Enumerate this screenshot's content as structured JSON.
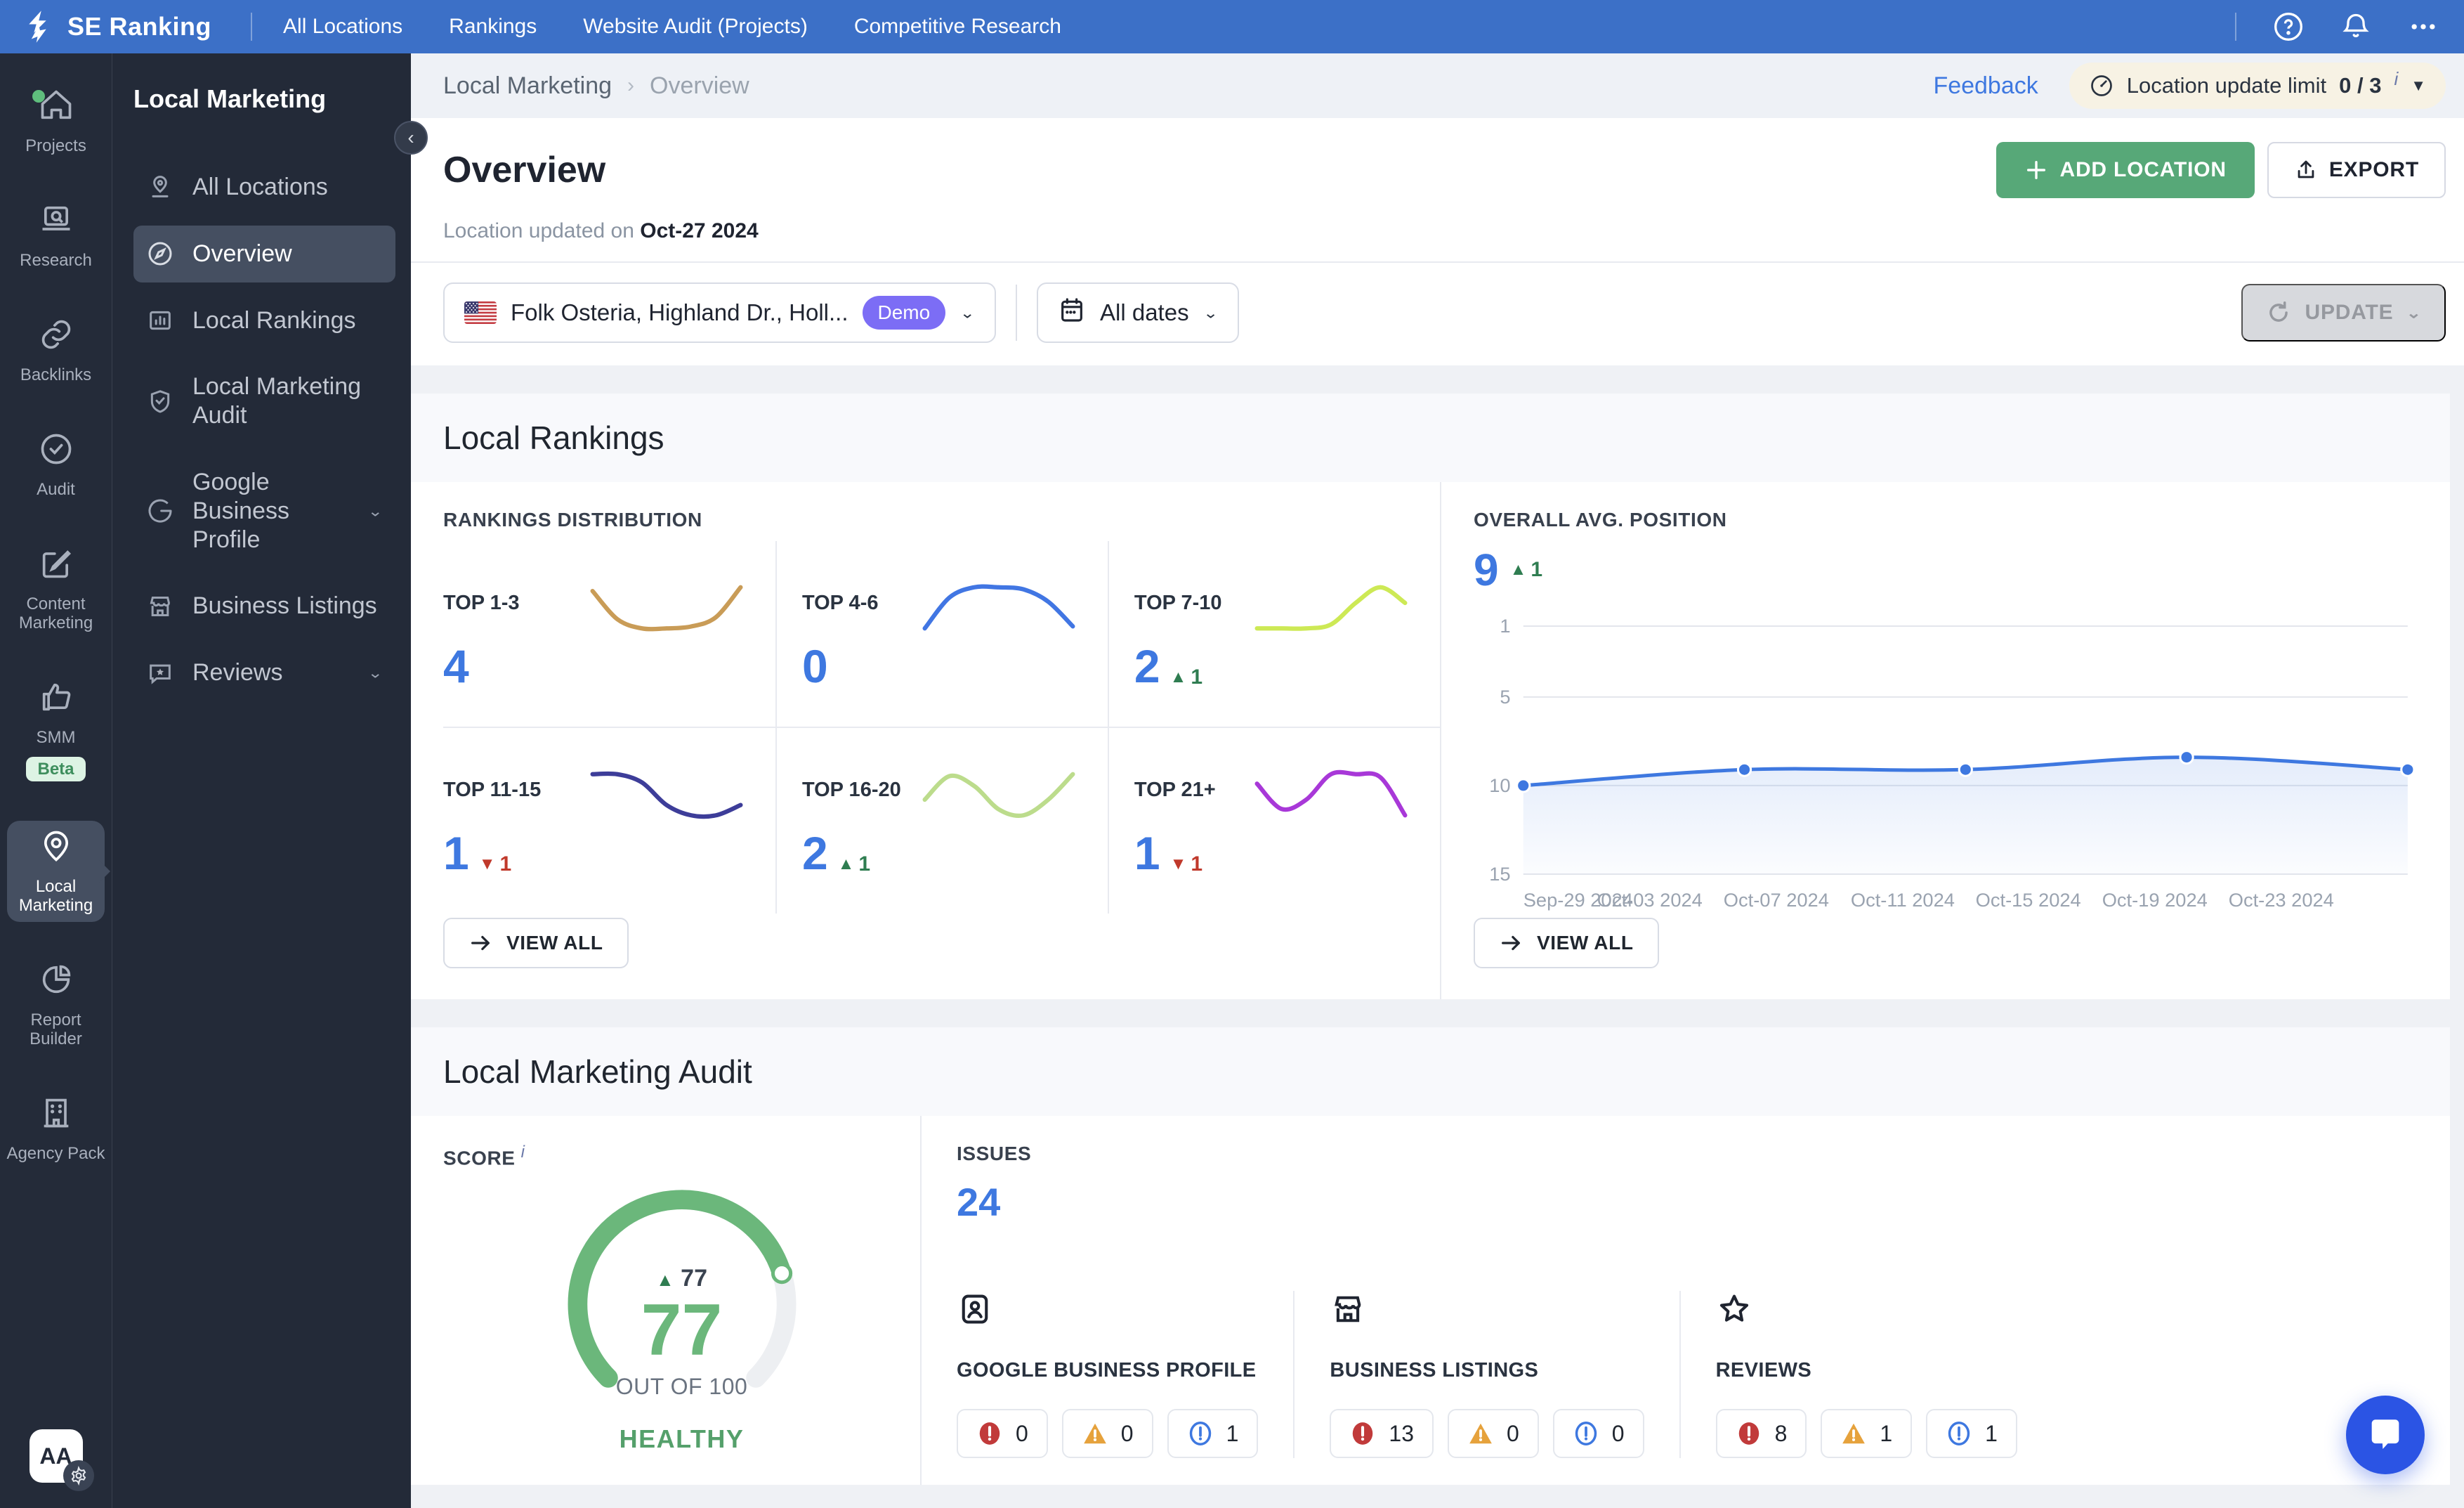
{
  "topnav": {
    "brand": "SE Ranking",
    "items": [
      "All Locations",
      "Rankings",
      "Website Audit (Projects)",
      "Competitive Research"
    ]
  },
  "rail": {
    "items": [
      {
        "label": "Projects",
        "icon": "home-icon"
      },
      {
        "label": "Research",
        "icon": "research-icon"
      },
      {
        "label": "Backlinks",
        "icon": "backlinks-icon"
      },
      {
        "label": "Audit",
        "icon": "audit-check-icon"
      },
      {
        "label": "Content Marketing",
        "icon": "content-marketing-icon"
      },
      {
        "label": "SMM",
        "icon": "thumbs-up-icon",
        "badge": "Beta"
      },
      {
        "label": "Local Marketing",
        "icon": "map-pin-icon"
      },
      {
        "label": "Report Builder",
        "icon": "pie-chart-icon"
      },
      {
        "label": "Agency Pack",
        "icon": "building-icon"
      }
    ],
    "avatar": "AA"
  },
  "sidebar": {
    "title": "Local Marketing",
    "items": [
      {
        "label": "All Locations",
        "icon": "location-pin-icon"
      },
      {
        "label": "Overview",
        "icon": "compass-icon"
      },
      {
        "label": "Local Rankings",
        "icon": "bar-chart-icon"
      },
      {
        "label": "Local Marketing Audit",
        "icon": "shield-check-icon"
      },
      {
        "label": "Google Business Profile",
        "icon": "google-icon"
      },
      {
        "label": "Business Listings",
        "icon": "storefront-icon"
      },
      {
        "label": "Reviews",
        "icon": "review-bubble-icon"
      }
    ]
  },
  "header": {
    "breadcrumb_root": "Local Marketing",
    "breadcrumb_current": "Overview",
    "feedback": "Feedback",
    "limit_label": "Location update limit",
    "limit_value": "0 / 3",
    "limit_info": "i",
    "title": "Overview",
    "updated_label": "Location updated on",
    "updated_date": "Oct-27 2024",
    "add_location": "ADD LOCATION",
    "export": "EXPORT"
  },
  "filters": {
    "location": "Folk Osteria, Highland Dr., Holl...",
    "location_badge": "Demo",
    "dates": "All dates",
    "update": "UPDATE"
  },
  "rankings": {
    "section_title": "Local Rankings",
    "distribution_title": "RANKINGS DISTRIBUTION",
    "view_all": "VIEW ALL",
    "cards": [
      {
        "label": "TOP 1-3",
        "value": "4",
        "delta": "",
        "dir": ""
      },
      {
        "label": "TOP 4-6",
        "value": "0",
        "delta": "",
        "dir": ""
      },
      {
        "label": "TOP 7-10",
        "value": "2",
        "delta": "1",
        "dir": "up"
      },
      {
        "label": "TOP 11-15",
        "value": "1",
        "delta": "1",
        "dir": "down"
      },
      {
        "label": "TOP 16-20",
        "value": "2",
        "delta": "1",
        "dir": "up"
      },
      {
        "label": "TOP 21+",
        "value": "1",
        "delta": "1",
        "dir": "down"
      }
    ],
    "avg_title": "OVERALL AVG. POSITION",
    "avg_value": "9",
    "avg_delta": "1",
    "avg_view_all": "VIEW ALL"
  },
  "audit": {
    "section_title": "Local Marketing Audit",
    "score_label": "SCORE",
    "score_info": "i",
    "score_delta": "77",
    "score_value": "77",
    "score_out_of": "OUT OF 100",
    "score_status": "HEALTHY",
    "issues_label": "ISSUES",
    "issues_value": "24",
    "categories": [
      {
        "label": "GOOGLE BUSINESS PROFILE",
        "icon": "profile-card-icon",
        "errors": "0",
        "warnings": "0",
        "notices": "1"
      },
      {
        "label": "BUSINESS LISTINGS",
        "icon": "storefront-icon",
        "errors": "13",
        "warnings": "0",
        "notices": "0"
      },
      {
        "label": "REVIEWS",
        "icon": "star-icon",
        "errors": "8",
        "warnings": "1",
        "notices": "1"
      }
    ]
  },
  "chart_data": [
    {
      "id": "overall-avg-position",
      "type": "line",
      "title": "OVERALL AVG. POSITION",
      "ylabel": "position",
      "y_inverted": true,
      "y_ticks": [
        1,
        5,
        10,
        15
      ],
      "ylim": [
        1,
        15
      ],
      "x_tick_labels": [
        "Sep-29 2024",
        "Oct-03 2024",
        "Oct-07 2024",
        "Oct-11 2024",
        "Oct-15 2024",
        "Oct-19 2024",
        "Oct-23 2024"
      ],
      "x_tick_fracs": [
        0,
        0.143,
        0.286,
        0.429,
        0.571,
        0.714,
        0.857
      ],
      "points": [
        {
          "x_frac": 0.0,
          "value": 10.0
        },
        {
          "x_frac": 0.25,
          "value": 9.1
        },
        {
          "x_frac": 0.5,
          "value": 9.1
        },
        {
          "x_frac": 0.75,
          "value": 8.4
        },
        {
          "x_frac": 1.0,
          "value": 9.1
        }
      ],
      "line_color": "#3E78E0",
      "grid": true,
      "legend": "none"
    },
    {
      "id": "rankings-sparklines",
      "type": "line",
      "series": [
        {
          "name": "TOP 1-3",
          "color": "#C99C57",
          "values": [
            5.0,
            2.0,
            1.0,
            1.0,
            1.2,
            2.2,
            5.4
          ]
        },
        {
          "name": "TOP 4-6",
          "color": "#4176E3",
          "values": [
            1.0,
            4.0,
            5.0,
            5.0,
            4.8,
            3.6,
            1.2
          ]
        },
        {
          "name": "TOP 7-10",
          "color": "#CDE955",
          "values": [
            1.0,
            1.0,
            1.0,
            1.4,
            3.6,
            5.2,
            3.6
          ]
        },
        {
          "name": "TOP 11-15",
          "color": "#3D3D99",
          "values": [
            5.0,
            5.0,
            4.2,
            2.0,
            1.0,
            1.0,
            2.0
          ]
        },
        {
          "name": "TOP 16-20",
          "color": "#BCDC8C",
          "values": [
            2.6,
            5.0,
            4.0,
            1.6,
            1.0,
            2.6,
            5.2
          ]
        },
        {
          "name": "TOP 21+",
          "color": "#A838D8",
          "values": [
            4.0,
            2.4,
            3.0,
            4.6,
            4.6,
            4.4,
            2.0
          ]
        }
      ]
    }
  ]
}
